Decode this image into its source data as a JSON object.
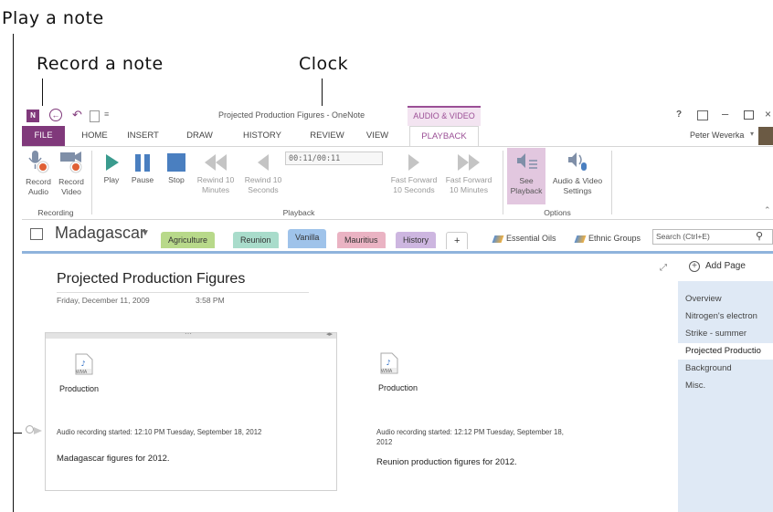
{
  "callouts": {
    "play": "Play a note",
    "record": "Record a note",
    "clock": "Clock"
  },
  "titlebar": {
    "title": "Projected Production Figures - OneNote",
    "context_tab": "AUDIO & VIDEO",
    "help": "?",
    "user": "Peter Weverka"
  },
  "tabs": [
    "FILE",
    "HOME",
    "INSERT",
    "DRAW",
    "HISTORY",
    "REVIEW",
    "VIEW",
    "PLAYBACK"
  ],
  "ribbon": {
    "record_audio": "Record Audio",
    "record_video": "Record Video",
    "play": "Play",
    "pause": "Pause",
    "stop": "Stop",
    "rewind10m": "Rewind 10 Minutes",
    "rewind10s": "Rewind 10 Seconds",
    "clock": "00:11/00:11",
    "ff10s": "Fast Forward 10 Seconds",
    "ff10m": "Fast Forward 10 Minutes",
    "see_playback": "See Playback",
    "av_settings": "Audio & Video Settings",
    "groups": {
      "recording": "Recording",
      "playback": "Playback",
      "options": "Options"
    }
  },
  "notebook": {
    "name": "Madagascar",
    "sections": [
      "Agriculture",
      "Reunion",
      "Vanilla",
      "Mauritius",
      "History",
      "+"
    ],
    "groups": [
      "Essential Oils",
      "Ethnic Groups"
    ],
    "search_placeholder": "Search (Ctrl+E)"
  },
  "page": {
    "title": "Projected Production Figures",
    "date": "Friday, December 11, 2009",
    "time": "3:58 PM",
    "container1": {
      "file_label": "Production",
      "recording": "Audio recording started: 12:10 PM Tuesday, September 18, 2012",
      "note": "Madagascar figures for 2012."
    },
    "container2": {
      "file_label": "Production",
      "recording": "Audio recording started: 12:12 PM Tuesday, September 18, 2012",
      "note": "Reunion production figures for 2012."
    },
    "wma": "WMA"
  },
  "pages_pane": {
    "add_page": "Add Page",
    "pages": [
      "Overview",
      "Nitrogen's electron",
      "Strike - summer",
      "Projected Productio",
      "Background",
      "Misc."
    ],
    "selected_index": 3
  },
  "colors": {
    "onenote_purple": "#80397b",
    "accent": "#9b4f96",
    "section_agriculture": "#b8d98a",
    "section_reunion": "#a9dccb",
    "section_vanilla": "#9fc3ea",
    "section_mauritius": "#eab3c3",
    "section_history": "#cdb6e0"
  }
}
